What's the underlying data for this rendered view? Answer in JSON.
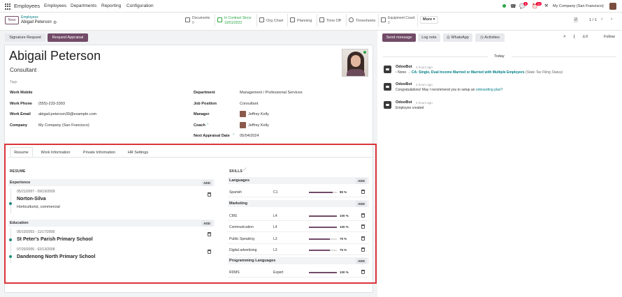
{
  "nav": {
    "app_title": "Employees",
    "menu": [
      "Employees",
      "Departments",
      "Reporting",
      "Configuration"
    ],
    "company": "My Company (San Francisco)",
    "chat_count": "6",
    "activity_count": "20"
  },
  "control": {
    "new_label": "New",
    "breadcrumb_parent": "Employees",
    "breadcrumb_current": "Abigail Peterson",
    "pager": "1 / 1",
    "more_label": "More"
  },
  "smart_buttons": {
    "documents": {
      "label": "Documents",
      "value": "0"
    },
    "contract": {
      "label": "In Contract Since",
      "value": "10/01/2023"
    },
    "org_chart": {
      "label": "Org Chart"
    },
    "planning": {
      "label": "Planning"
    },
    "time_off": {
      "label": "Time Off"
    },
    "timesheets": {
      "label": "Timesheets"
    },
    "equipment": {
      "label": "Equipment Count",
      "value": "2"
    }
  },
  "actions": {
    "signature": "Signature Request",
    "appraisal": "Request Appraisal"
  },
  "employee": {
    "name": "Abigail Peterson",
    "job_title": "Consultant",
    "tags_placeholder": "Tags",
    "work_mobile_label": "Work Mobile",
    "work_mobile": "",
    "work_phone_label": "Work Phone",
    "work_phone": "(555)-233-3393",
    "work_email_label": "Work Email",
    "work_email": "abigail.peterson39@example.com",
    "company_label": "Company",
    "company": "My Company (San Francisco)",
    "department_label": "Department",
    "department": "Management / Professional Services",
    "job_position_label": "Job Position",
    "job_position": "Consultant",
    "manager_label": "Manager",
    "manager": "Jeffrey Kelly",
    "coach_label": "Coach",
    "coach": "Jeffrey Kelly",
    "appraisal_label": "Next Appraisal Date",
    "appraisal_date": "05/04/2024"
  },
  "tabs": [
    "Resume",
    "Work Information",
    "Private Information",
    "HR Settings"
  ],
  "resume": {
    "title": "RESUME",
    "add_label": "ADD",
    "experience_title": "Experience",
    "experience": [
      {
        "dates": "05/21/2007 - 09/19/2009",
        "title": "Norton-Silva",
        "desc": "Horticulturist, commercial"
      }
    ],
    "education_title": "Education",
    "education": [
      {
        "dates": "05/10/2003 - 11/17/2008",
        "title": "St Peter's Parish Primary School"
      },
      {
        "dates": "07/20/2005 - 02/13/2008",
        "title": "Dandenong North Primary School"
      }
    ]
  },
  "skills": {
    "title": "SKILLS",
    "add_label": "ADD",
    "groups": [
      {
        "name": "Languages",
        "rows": [
          {
            "skill": "Spanish",
            "level": "C1",
            "progress": 85,
            "pct": "85 %"
          }
        ]
      },
      {
        "name": "Marketing",
        "rows": [
          {
            "skill": "CMS",
            "level": "L4",
            "progress": 100,
            "pct": "100 %"
          },
          {
            "skill": "Communication",
            "level": "L4",
            "progress": 100,
            "pct": "100 %"
          },
          {
            "skill": "Public Speaking",
            "level": "L3",
            "progress": 75,
            "pct": "75 %"
          },
          {
            "skill": "Digital advertising",
            "level": "L3",
            "progress": 75,
            "pct": "75 %"
          }
        ]
      },
      {
        "name": "Programming Languages",
        "rows": [
          {
            "skill": "RDMS",
            "level": "Expert",
            "progress": 100,
            "pct": "100 %"
          }
        ]
      }
    ]
  },
  "chatter": {
    "send_message": "Send message",
    "log_note": "Log note",
    "whatsapp": "WhatsApp",
    "activities": "Activities",
    "followers": "0",
    "follow": "Follow",
    "date_sep": "Today",
    "messages": [
      {
        "author": "OdooBot",
        "time": "2 hours ago",
        "prefix": "None",
        "change": "CA: Single, Dual Income Married or Married with Multiple Employers",
        "field": "(State Tax Filing Status)"
      },
      {
        "author": "OdooBot",
        "time": "2 hours ago",
        "text": "Congratulations! May I recommend you to setup an",
        "link": "onboarding plan?"
      },
      {
        "author": "OdooBot",
        "time": "2 hours ago",
        "text": "Employee created"
      }
    ]
  }
}
